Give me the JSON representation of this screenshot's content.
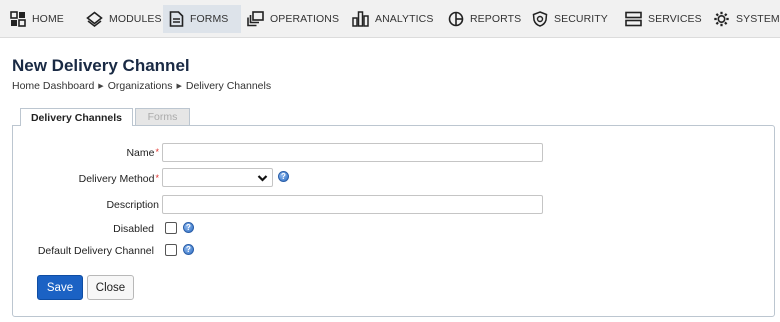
{
  "nav": {
    "items": [
      {
        "label": "HOME",
        "icon": "home-grid-icon"
      },
      {
        "label": "MODULES",
        "icon": "modules-diamond-icon"
      },
      {
        "label": "FORMS",
        "icon": "form-document-icon",
        "active": true
      },
      {
        "label": "OPERATIONS",
        "icon": "operations-windows-icon"
      },
      {
        "label": "ANALYTICS",
        "icon": "analytics-bars-icon"
      },
      {
        "label": "REPORTS",
        "icon": "reports-pie-icon"
      },
      {
        "label": "SECURITY",
        "icon": "security-shield-icon"
      },
      {
        "label": "SERVICES",
        "icon": "services-server-icon"
      },
      {
        "label": "SYSTEM",
        "icon": "system-gear-icon"
      }
    ],
    "active_bg": "#dde3ea"
  },
  "page": {
    "title": "New Delivery Channel",
    "breadcrumb": [
      "Home Dashboard",
      "Organizations",
      "Delivery Channels"
    ]
  },
  "tabs": [
    {
      "label": "Delivery Channels",
      "active": true
    },
    {
      "label": "Forms",
      "active": false
    }
  ],
  "form": {
    "name": {
      "label": "Name",
      "required_mark": "*",
      "value": ""
    },
    "delivery_method": {
      "label": "Delivery Method",
      "required_mark": "*",
      "selected": ""
    },
    "description": {
      "label": "Description",
      "value": ""
    },
    "disabled": {
      "label": "Disabled",
      "checked": false
    },
    "default_channel": {
      "label": "Default Delivery Channel",
      "checked": false
    },
    "help_glyph": "?"
  },
  "buttons": {
    "save": "Save",
    "close": "Close"
  },
  "colors": {
    "primary": "#1b62c4",
    "required": "#e0302a",
    "title": "#1a2a44"
  }
}
